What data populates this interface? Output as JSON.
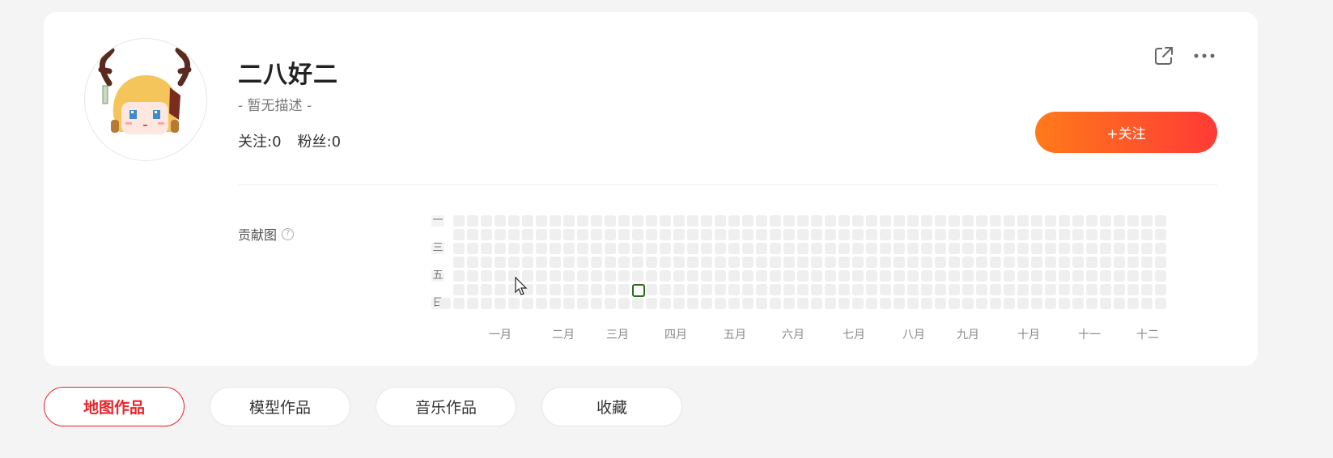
{
  "profile": {
    "username": "二八好二",
    "description": "- 暂无描述 -",
    "following_label": "关注:0",
    "followers_label": "粉丝:0",
    "follow_button_label": "+关注"
  },
  "icons": {
    "share": "share-external-icon",
    "more": "more-dots-icon",
    "help": "question-circle-icon"
  },
  "colors": {
    "accent_start": "#ff7a1a",
    "accent_end": "#ff3a36",
    "active_tab": "#e8242a",
    "active_cell_border": "#2f6a1f",
    "empty_cell": "#efefef"
  },
  "contributions": {
    "label": "贡献图",
    "help_glyph": "?",
    "day_labels": [
      "一",
      "三",
      "五",
      "日"
    ],
    "month_labels": [
      "一月",
      "二月",
      "三月",
      "四月",
      "五月",
      "六月",
      "七月",
      "八月",
      "九月",
      "十月",
      "十一",
      "十二"
    ],
    "weeks": 53,
    "days_per_week": 7,
    "active_cells": [
      {
        "week": 14,
        "day": 5,
        "count": 1
      }
    ]
  },
  "tabs": [
    {
      "label": "地图作品",
      "active": true
    },
    {
      "label": "模型作品",
      "active": false
    },
    {
      "label": "音乐作品",
      "active": false
    },
    {
      "label": "收藏",
      "active": false
    }
  ]
}
